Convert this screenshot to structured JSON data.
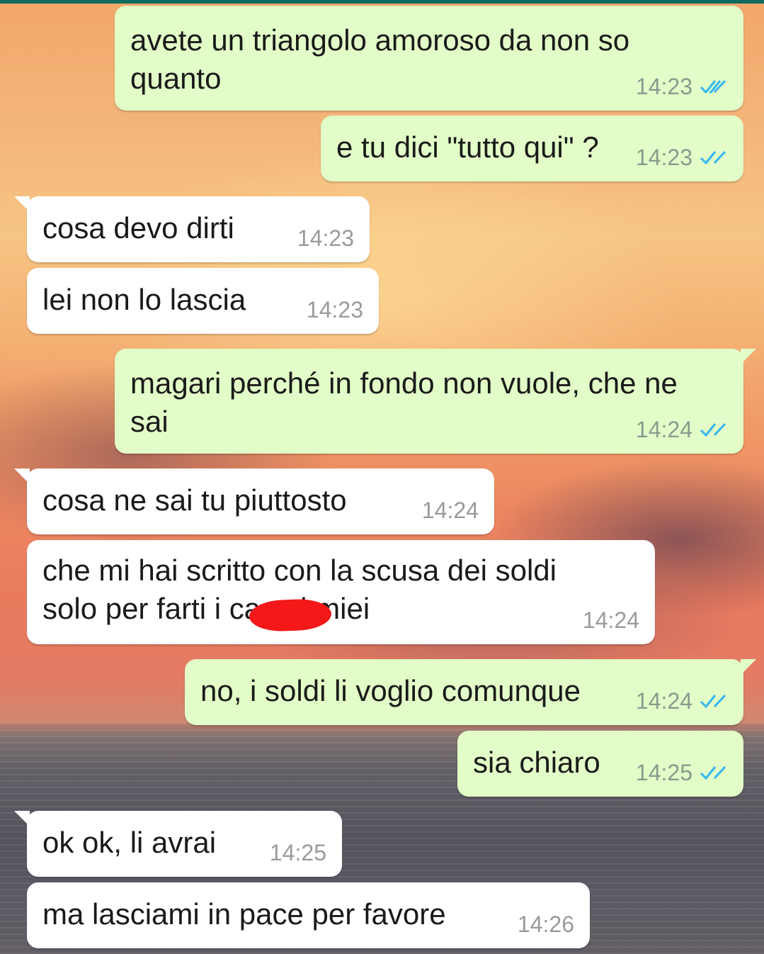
{
  "chat": {
    "messages": [
      {
        "side": "out",
        "text": "avete un triangolo amoroso da non so\nquanto",
        "time": "14:23",
        "status": "read"
      },
      {
        "side": "out",
        "text": "e tu dici \"tutto qui\" ?",
        "time": "14:23",
        "status": "read"
      },
      {
        "side": "in",
        "text": "cosa devo dirti",
        "time": "14:23"
      },
      {
        "side": "in",
        "text": "lei non lo lascia",
        "time": "14:23"
      },
      {
        "side": "out",
        "text": "magari perché in fondo non vuole, che ne\nsai",
        "time": "14:24",
        "status": "read"
      },
      {
        "side": "in",
        "text": "cosa ne sai tu piuttosto",
        "time": "14:24"
      },
      {
        "side": "in",
        "text": "che mi hai scritto con la scusa dei soldi\nsolo per farti i ca   zi miei",
        "time": "14:24",
        "redacted": true
      },
      {
        "side": "out",
        "text": "no, i soldi li voglio comunque",
        "time": "14:24",
        "status": "read"
      },
      {
        "side": "out",
        "text": "sia chiaro",
        "time": "14:25",
        "status": "read"
      },
      {
        "side": "in",
        "text": "ok ok, li avrai",
        "time": "14:25"
      },
      {
        "side": "in",
        "text": "ma lasciami in pace per favore",
        "time": "14:26"
      }
    ]
  },
  "colors": {
    "outgoing_bubble": "#e2fdc7",
    "incoming_bubble": "#ffffff",
    "read_ticks": "#34b7f1",
    "redaction": "#f41818"
  },
  "icons": {
    "read_receipt": "double-check-icon"
  }
}
